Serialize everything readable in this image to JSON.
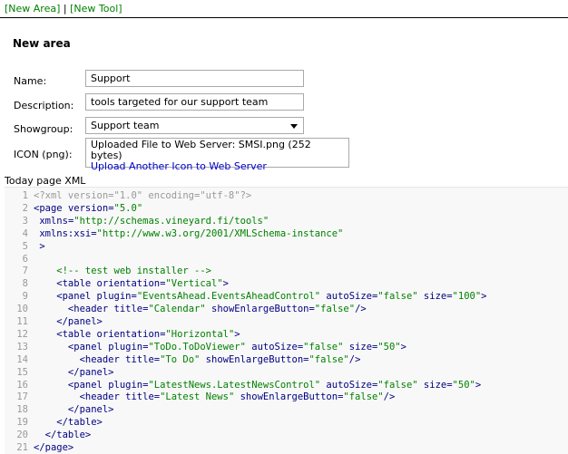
{
  "top_links": {
    "new_area": "[New Area]",
    "separator": "|",
    "new_tool": "[New Tool]"
  },
  "section_title": "New area",
  "form": {
    "name_label": "Name:",
    "name_value": "Support",
    "description_label": "Description:",
    "description_value": "tools targeted for our support team",
    "showgroup_label": "Showgroup:",
    "showgroup_value": "Support team",
    "icon_label": "ICON (png):",
    "icon_status": "Uploaded File to Web Server: SMSI.png (252 bytes)",
    "icon_upload_link": "Upload Another Icon to Web Server"
  },
  "xml_label": "Today page XML",
  "colors": {
    "link_green": "#008000",
    "link_blue": "#0000cc",
    "code_tag": "#000080",
    "code_value": "#008000",
    "line_number": "#999999",
    "editor_background": "#f8f8f8"
  },
  "xml_lines": [
    {
      "n": "1",
      "tokens": [
        {
          "t": "pi",
          "s": "<?xml version=\"1.0\" encoding=\"utf-8\"?>"
        }
      ]
    },
    {
      "n": "2",
      "tokens": [
        {
          "t": "tag",
          "s": "<page "
        },
        {
          "t": "attr",
          "s": "version"
        },
        {
          "t": "p",
          "s": "="
        },
        {
          "t": "val",
          "s": "\"5.0\""
        }
      ]
    },
    {
      "n": "3",
      "tokens": [
        {
          "t": "attr",
          "s": " xmlns"
        },
        {
          "t": "p",
          "s": "="
        },
        {
          "t": "val",
          "s": "\"http://schemas.vineyard.fi/tools\""
        }
      ]
    },
    {
      "n": "4",
      "tokens": [
        {
          "t": "attr",
          "s": " xmlns:xsi"
        },
        {
          "t": "p",
          "s": "="
        },
        {
          "t": "val",
          "s": "\"http://www.w3.org/2001/XMLSchema-instance\""
        }
      ]
    },
    {
      "n": "5",
      "tokens": [
        {
          "t": "tag",
          "s": " >"
        }
      ]
    },
    {
      "n": "6",
      "tokens": []
    },
    {
      "n": "7",
      "tokens": [
        {
          "t": "cm",
          "s": "    <!-- test web installer -->"
        }
      ]
    },
    {
      "n": "8",
      "tokens": [
        {
          "t": "tag",
          "s": "    <table "
        },
        {
          "t": "attr",
          "s": "orientation"
        },
        {
          "t": "p",
          "s": "="
        },
        {
          "t": "val",
          "s": "\"Vertical\""
        },
        {
          "t": "tag",
          "s": ">"
        }
      ]
    },
    {
      "n": "9",
      "tokens": [
        {
          "t": "tag",
          "s": "    <panel "
        },
        {
          "t": "attr",
          "s": "plugin"
        },
        {
          "t": "p",
          "s": "="
        },
        {
          "t": "val",
          "s": "\"EventsAhead.EventsAheadControl\""
        },
        {
          "t": "attr",
          "s": " autoSize"
        },
        {
          "t": "p",
          "s": "="
        },
        {
          "t": "val",
          "s": "\"false\""
        },
        {
          "t": "attr",
          "s": " size"
        },
        {
          "t": "p",
          "s": "="
        },
        {
          "t": "val",
          "s": "\"100\""
        },
        {
          "t": "tag",
          "s": ">"
        }
      ]
    },
    {
      "n": "10",
      "tokens": [
        {
          "t": "tag",
          "s": "      <header "
        },
        {
          "t": "attr",
          "s": "title"
        },
        {
          "t": "p",
          "s": "="
        },
        {
          "t": "val",
          "s": "\"Calendar\""
        },
        {
          "t": "attr",
          "s": " showEnlargeButton"
        },
        {
          "t": "p",
          "s": "="
        },
        {
          "t": "val",
          "s": "\"false\""
        },
        {
          "t": "tag",
          "s": "/>"
        }
      ]
    },
    {
      "n": "11",
      "tokens": [
        {
          "t": "tag",
          "s": "    </panel>"
        }
      ]
    },
    {
      "n": "12",
      "tokens": [
        {
          "t": "tag",
          "s": "    <table "
        },
        {
          "t": "attr",
          "s": "orientation"
        },
        {
          "t": "p",
          "s": "="
        },
        {
          "t": "val",
          "s": "\"Horizontal\""
        },
        {
          "t": "tag",
          "s": ">"
        }
      ]
    },
    {
      "n": "13",
      "tokens": [
        {
          "t": "tag",
          "s": "      <panel "
        },
        {
          "t": "attr",
          "s": "plugin"
        },
        {
          "t": "p",
          "s": "="
        },
        {
          "t": "val",
          "s": "\"ToDo.ToDoViewer\""
        },
        {
          "t": "attr",
          "s": " autoSize"
        },
        {
          "t": "p",
          "s": "="
        },
        {
          "t": "val",
          "s": "\"false\""
        },
        {
          "t": "attr",
          "s": " size"
        },
        {
          "t": "p",
          "s": "="
        },
        {
          "t": "val",
          "s": "\"50\""
        },
        {
          "t": "tag",
          "s": ">"
        }
      ]
    },
    {
      "n": "14",
      "tokens": [
        {
          "t": "tag",
          "s": "        <header "
        },
        {
          "t": "attr",
          "s": "title"
        },
        {
          "t": "p",
          "s": "="
        },
        {
          "t": "val",
          "s": "\"To Do\""
        },
        {
          "t": "attr",
          "s": " showEnlargeButton"
        },
        {
          "t": "p",
          "s": "="
        },
        {
          "t": "val",
          "s": "\"false\""
        },
        {
          "t": "tag",
          "s": "/>"
        }
      ]
    },
    {
      "n": "15",
      "tokens": [
        {
          "t": "tag",
          "s": "      </panel>"
        }
      ]
    },
    {
      "n": "16",
      "tokens": [
        {
          "t": "tag",
          "s": "      <panel "
        },
        {
          "t": "attr",
          "s": "plugin"
        },
        {
          "t": "p",
          "s": "="
        },
        {
          "t": "val",
          "s": "\"LatestNews.LatestNewsControl\""
        },
        {
          "t": "attr",
          "s": " autoSize"
        },
        {
          "t": "p",
          "s": "="
        },
        {
          "t": "val",
          "s": "\"false\""
        },
        {
          "t": "attr",
          "s": " size"
        },
        {
          "t": "p",
          "s": "="
        },
        {
          "t": "val",
          "s": "\"50\""
        },
        {
          "t": "tag",
          "s": ">"
        }
      ]
    },
    {
      "n": "17",
      "tokens": [
        {
          "t": "tag",
          "s": "        <header "
        },
        {
          "t": "attr",
          "s": "title"
        },
        {
          "t": "p",
          "s": "="
        },
        {
          "t": "val",
          "s": "\"Latest News\""
        },
        {
          "t": "attr",
          "s": " showEnlargeButton"
        },
        {
          "t": "p",
          "s": "="
        },
        {
          "t": "val",
          "s": "\"false\""
        },
        {
          "t": "tag",
          "s": "/>"
        }
      ]
    },
    {
      "n": "18",
      "tokens": [
        {
          "t": "tag",
          "s": "      </panel>"
        }
      ]
    },
    {
      "n": "19",
      "tokens": [
        {
          "t": "tag",
          "s": "    </table>"
        }
      ]
    },
    {
      "n": "20",
      "tokens": [
        {
          "t": "tag",
          "s": "  </table>"
        }
      ]
    },
    {
      "n": "21",
      "tokens": [
        {
          "t": "tag",
          "s": "</page>"
        }
      ]
    }
  ]
}
